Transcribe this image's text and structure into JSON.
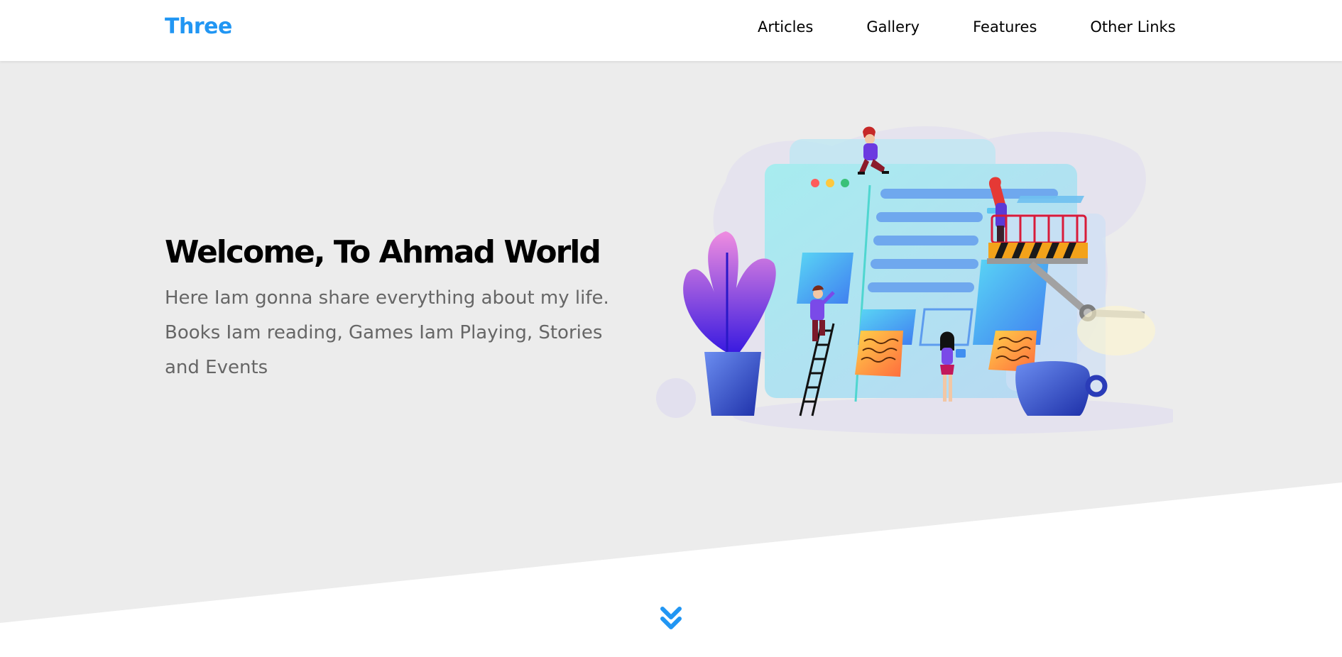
{
  "header": {
    "logo": "Three",
    "nav": [
      {
        "label": "Articles"
      },
      {
        "label": "Gallery"
      },
      {
        "label": "Features"
      },
      {
        "label": "Other Links"
      }
    ]
  },
  "hero": {
    "title": "Welcome, To Ahmad World",
    "description": "Here Iam gonna share everything about my life. Books Iam reading, Games Iam Playing, Stories and Events"
  },
  "colors": {
    "brand": "#2196f3",
    "hero_background": "#ececec",
    "text_dark": "#000000",
    "text_muted": "#666666"
  },
  "icons": {
    "scroll_down": "double-chevron-down-icon"
  }
}
